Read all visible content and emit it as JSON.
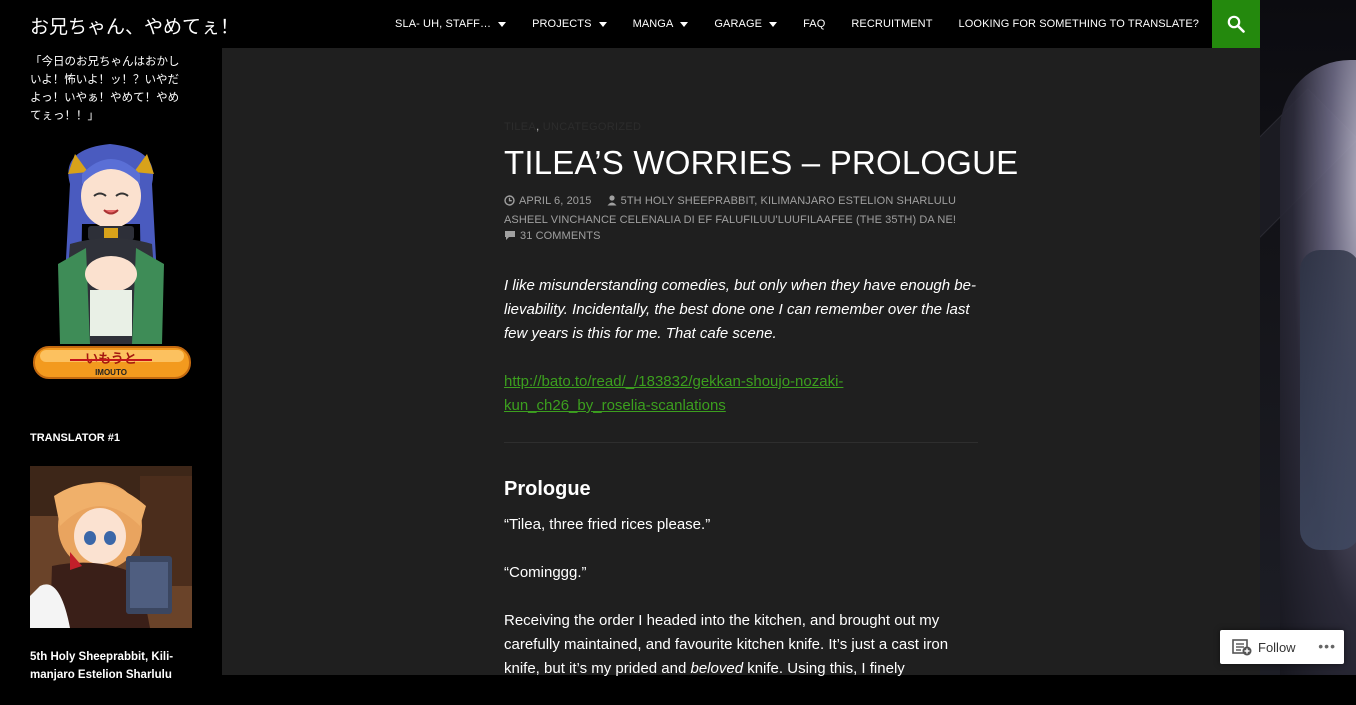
{
  "site": {
    "title": "お兄ちゃん、やめてぇ！",
    "tagline": "「今日のお兄ちゃんはおかしいよ！怖いよ！ッ！？いやだよっ！いやぁ！やめて！やめてぇっ！！」"
  },
  "nav": {
    "items": [
      {
        "label": "SLA- UH, STAFF…",
        "has_dropdown": true
      },
      {
        "label": "PROJECTS",
        "has_dropdown": true
      },
      {
        "label": "MANGA",
        "has_dropdown": true
      },
      {
        "label": "GARAGE",
        "has_dropdown": true
      },
      {
        "label": "FAQ",
        "has_dropdown": false
      },
      {
        "label": "RECRUITMENT",
        "has_dropdown": false
      },
      {
        "label": "LOOKING FOR SOMETHING TO TRANSLATE?",
        "has_dropdown": false
      }
    ],
    "search_icon": "search-icon",
    "accent_color": "#24890d"
  },
  "sidebar": {
    "imouto_badge": {
      "label_jp": "いもうと",
      "label_en": "IMOUTO"
    },
    "widget_title": "TRANSLATOR #1",
    "translator_name": "5th Holy Sheeprabbit, Kili-manjaro Estelion Sharlulu"
  },
  "article": {
    "categories": [
      "TILEA",
      "UNCATEGORIZED"
    ],
    "title": "TILEA’S WORRIES – PROLOGUE",
    "date": "APRIL 6, 2015",
    "author": "5TH HOLY SHEEPRABBIT, KILIMANJARO ESTELION SHARLULU ASHEEL VINCHANCE CELENALIA DI EF FALUFILUU'LUUFILAAFEE (THE 35TH) DA NE!",
    "comments": "31 COMMENTS",
    "intro": "I like misunderstanding comedies, but only when they have enough be-lievability. Incidentally, the best done one I can remember over the last few years is this for me. That cafe scene.",
    "link": "http://bato.to/read/_/183832/gekkan-shoujo-nozaki-kun_ch26_by_roselia-scanlations",
    "section_heading": "Prologue",
    "paragraphs": [
      "“Tilea, three fried rices please.”",
      "“Cominggg.”"
    ],
    "para3_start": "Receiving the order I headed into the kitchen, and brought out my carefully maintained, and favourite kitchen knife. It’s just a cast iron knife, but it’s my prided and ",
    "para3_em": "beloved",
    "para3_end": " knife. Using this, I finely"
  },
  "follow": {
    "label": "Follow",
    "more": "•••"
  }
}
